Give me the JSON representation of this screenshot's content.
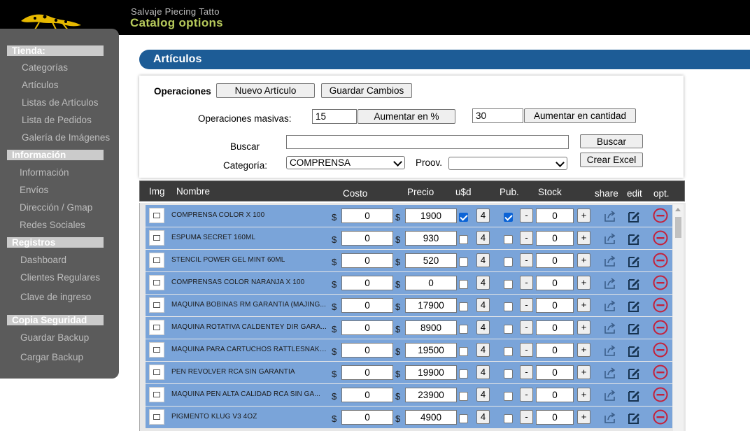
{
  "header": {
    "site_name": "Salvaje Piecing Tatto",
    "page_title": "Catalog options"
  },
  "sidebar": {
    "sections": [
      {
        "title": "Tienda:",
        "items": [
          "Categorías",
          "Artículos",
          "Listas de Artículos",
          "Lista de Pedidos",
          "Galería de Imágenes"
        ]
      },
      {
        "title": "Información",
        "items": [
          "Información",
          "Envíos",
          "Dirección / Gmap",
          "Redes Sociales"
        ]
      },
      {
        "title": "Registros",
        "items": [
          "Dashboard",
          "Clientes Regulares",
          "Clave de ingreso"
        ]
      },
      {
        "title": "Copia Seguridad",
        "items": [
          "Guardar Backup",
          "Cargar Backup"
        ]
      }
    ]
  },
  "main": {
    "section_title": "Artículos",
    "operations_label": "Operaciones",
    "new_article_button": "Nuevo Artículo",
    "save_changes_button": "Guardar Cambios",
    "bulk_label": "Operaciones masivas:",
    "percent_value": "15",
    "percent_button": "Aumentar en %",
    "amount_value": "30",
    "amount_button": "Aumentar en cantidad",
    "search_label": "Buscar",
    "search_value": "",
    "search_button": "Buscar",
    "category_label": "Categoría:",
    "category_selected": "COMPRENSA",
    "provider_label": "Proov.",
    "provider_selected": "",
    "excel_button": "Crear Excel"
  },
  "table": {
    "columns": [
      "Img",
      "Nombre",
      "Costo",
      "Precio",
      "u$d",
      "Pub.",
      "Stock",
      "share",
      "edit",
      "opt."
    ],
    "currency_symbol": "$",
    "rows": [
      {
        "name": "COMPRENSA COLOR X 100",
        "cost": "0",
        "price": "1900",
        "usd": true,
        "qty": "4",
        "pub": true,
        "stock": "0"
      },
      {
        "name": "ESPUMA SECRET 160ML",
        "cost": "0",
        "price": "930",
        "usd": false,
        "qty": "4",
        "pub": false,
        "stock": "0"
      },
      {
        "name": "STENCIL POWER GEL MINT 60ML",
        "cost": "0",
        "price": "520",
        "usd": false,
        "qty": "4",
        "pub": false,
        "stock": "0"
      },
      {
        "name": "COMPRENSAS COLOR NARANJA X 100",
        "cost": "0",
        "price": "0",
        "usd": false,
        "qty": "4",
        "pub": false,
        "stock": "0"
      },
      {
        "name": "MAQUINA BOBINAS RM GARANTIA (MAJING...",
        "cost": "0",
        "price": "17900",
        "usd": false,
        "qty": "4",
        "pub": false,
        "stock": "0"
      },
      {
        "name": "MAQUINA ROTATIVA CALDENTEY DIR GARA...",
        "cost": "0",
        "price": "8900",
        "usd": false,
        "qty": "4",
        "pub": false,
        "stock": "0"
      },
      {
        "name": "MAQUINA PARA CARTUCHOS RATTLESNAKE ...",
        "cost": "0",
        "price": "19500",
        "usd": false,
        "qty": "4",
        "pub": false,
        "stock": "0"
      },
      {
        "name": "PEN REVOLVER RCA SIN GARANTIA",
        "cost": "0",
        "price": "19900",
        "usd": false,
        "qty": "4",
        "pub": false,
        "stock": "0"
      },
      {
        "name": "MAQUINA PEN ALTA CALIDAD RCA SIN GA...",
        "cost": "0",
        "price": "23900",
        "usd": false,
        "qty": "4",
        "pub": false,
        "stock": "0"
      },
      {
        "name": "PIGMENTO KLUG V3 4OZ",
        "cost": "0",
        "price": "4900",
        "usd": false,
        "qty": "4",
        "pub": false,
        "stock": "0"
      }
    ],
    "minus_label": "-",
    "plus_label": "+"
  },
  "colors": {
    "banner": "#1d5c96",
    "row": "#7aa4d9",
    "title_accent": "#b6c95b",
    "delete_icon": "#c4213a"
  }
}
